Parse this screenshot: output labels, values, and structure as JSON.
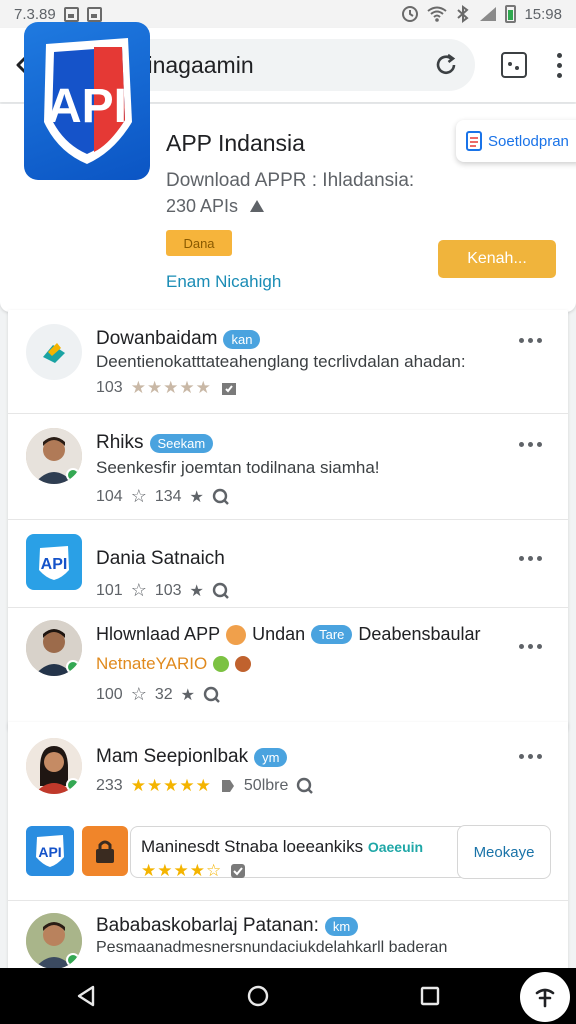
{
  "status_bar": {
    "left_time": "7.3.89",
    "right_time": "15:98"
  },
  "url_bar": {
    "url": "inghinagaamin"
  },
  "hero": {
    "app_name": "APP Indansia",
    "subtitle": "Download APPR : Ihladansia:",
    "count": "230 APIs",
    "badge": "Dana",
    "link": "Enam Nicahigh",
    "cta": "Kenah...",
    "floating_tip": "Soetlodpran",
    "logo_text": "API"
  },
  "list": [
    {
      "title": "Dowanbaidam",
      "pill": "kan",
      "subtitle": "Deentienokatttateahenglang tecrlivdalan ahadan:",
      "count": "103",
      "stars": "★★★★★",
      "stars_style": "grey",
      "avatar": "app-icon"
    },
    {
      "title": "Rhiks",
      "pill": "Seekam",
      "subtitle": "Seenkesfir joemtan todilnana siamha!",
      "count": "104",
      "rating": "134",
      "avatar": "person"
    },
    {
      "title": "Dania Satnaich",
      "subtitle": "",
      "count": "101",
      "rating": "103",
      "avatar": "api-logo"
    },
    {
      "title": "Hlownlaad APP",
      "title_tail": "Undan",
      "pill": "Tare",
      "title_end": "Deabensbaular",
      "subtitle": "NetnateYARIO",
      "count": "100",
      "rating": "32",
      "avatar": "person"
    }
  ],
  "list2": [
    {
      "title": "Mam Seepionlbak",
      "pill": "ym",
      "count": "233",
      "stars": "★★★★★",
      "rating_text": "50lbre",
      "avatar": "person-female"
    },
    {
      "title": "Bababaskobarlaj Patanan:",
      "pill": "km",
      "subtitle": "Pesmaanadmesnersnundaciukdelahkarll baderan",
      "avatar": "person"
    }
  ],
  "promo": {
    "text": "Maninesdt Stnaba loeeankiks",
    "highlight": "Oaeeuin",
    "stars": "★★★★☆",
    "button": "Meokaye"
  },
  "colors": {
    "accent_blue": "#1a73e8",
    "cta_orange": "#f0b43c",
    "star_gold": "#f4b400",
    "pill_blue": "#4aa3df"
  }
}
